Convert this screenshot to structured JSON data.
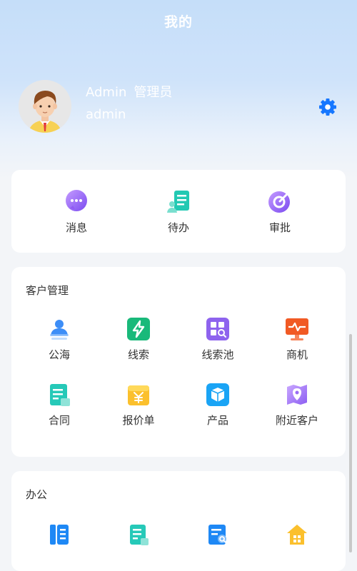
{
  "header": {
    "title": "我的"
  },
  "profile": {
    "name": "Admin",
    "role": "管理员",
    "account": "admin",
    "avatar_icon": "avatar-man-icon",
    "settings_icon": "gear-icon"
  },
  "quick_actions": [
    {
      "label": "消息",
      "icon": "message-bubble-icon"
    },
    {
      "label": "待办",
      "icon": "todo-list-icon"
    },
    {
      "label": "审批",
      "icon": "approval-icon"
    }
  ],
  "customer_management": {
    "title": "客户管理",
    "items": [
      {
        "label": "公海",
        "icon": "public-sea-icon"
      },
      {
        "label": "线索",
        "icon": "lightning-icon"
      },
      {
        "label": "线索池",
        "icon": "lead-pool-icon"
      },
      {
        "label": "商机",
        "icon": "opportunity-monitor-icon"
      },
      {
        "label": "合同",
        "icon": "contract-icon"
      },
      {
        "label": "报价单",
        "icon": "quotation-icon"
      },
      {
        "label": "产品",
        "icon": "product-box-icon"
      },
      {
        "label": "附近客户",
        "icon": "nearby-location-icon"
      }
    ]
  },
  "office": {
    "title": "办公",
    "items": [
      {
        "icon": "journal-icon"
      },
      {
        "icon": "report-icon"
      },
      {
        "icon": "search-document-icon"
      },
      {
        "icon": "home-icon"
      }
    ]
  },
  "colors": {
    "accent": "#1e90ff",
    "hero_top": "#c5def9",
    "page_bg": "#f3f5f8"
  }
}
